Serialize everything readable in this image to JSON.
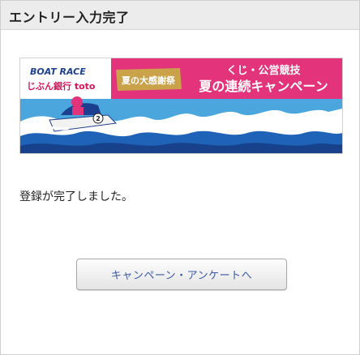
{
  "header": {
    "title": "エントリー入力完了"
  },
  "banner": {
    "brand_top": "BOAT RACE",
    "brand_bottom": "じぶん銀行 toto",
    "badge": "夏の大感謝祭",
    "line1": "くじ・公営競技",
    "line2": "夏の連続キャンペーン",
    "boat_number": "2",
    "colors": {
      "pink": "#e3337a",
      "sky": "#4aa6dc",
      "navy": "#1d3f8f",
      "gold": "#c9a24a"
    }
  },
  "message": "登録が完了しました。",
  "button": {
    "label": "キャンペーン・アンケートへ"
  }
}
